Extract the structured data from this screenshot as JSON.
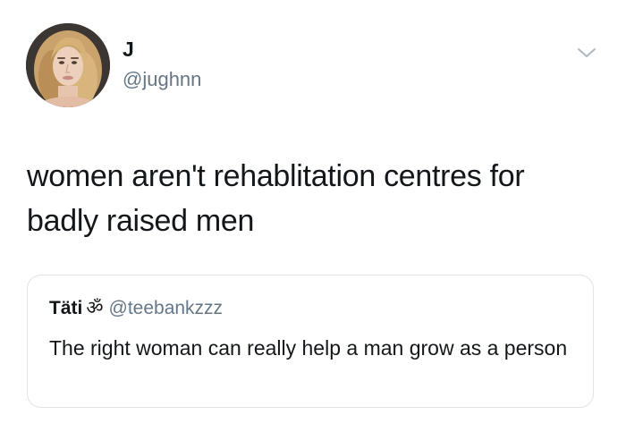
{
  "tweet": {
    "display_name": "J",
    "handle": "@jughnn",
    "text": "women aren't rehablitation centres for badly raised men",
    "menu_icon": "chevron-down-icon"
  },
  "quoted_tweet": {
    "display_name": "Täti",
    "name_emoji": "ॐ",
    "handle": "@teebankzzz",
    "text": "The right woman can really help a man grow as a person"
  },
  "colors": {
    "text_primary": "#14171a",
    "text_secondary": "#657786",
    "border": "#dfe4e8",
    "chevron": "#aab8c2"
  }
}
